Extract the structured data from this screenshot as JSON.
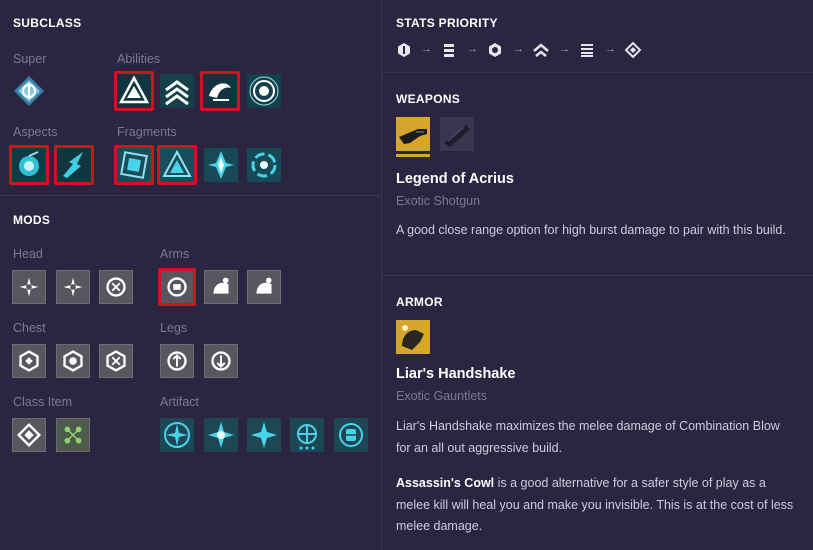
{
  "subclass": {
    "title": "SUBCLASS",
    "super_label": "Super",
    "abilities_label": "Abilities",
    "aspects_label": "Aspects",
    "fragments_label": "Fragments"
  },
  "mods": {
    "title": "MODS",
    "head_label": "Head",
    "arms_label": "Arms",
    "chest_label": "Chest",
    "legs_label": "Legs",
    "class_item_label": "Class Item",
    "artifact_label": "Artifact"
  },
  "stats": {
    "title": "STATS PRIORITY",
    "icons": [
      "mobility-icon",
      "resilience-icon",
      "recovery-icon",
      "discipline-icon",
      "intellect-icon",
      "strength-icon"
    ],
    "arrow": "→"
  },
  "weapons": {
    "title": "WEAPONS",
    "name": "Legend of Acrius",
    "type": "Exotic Shotgun",
    "description": "A good close range option for high burst damage to pair with this build."
  },
  "armor": {
    "title": "ARMOR",
    "name": "Liar's Handshake",
    "type": "Exotic Gauntlets",
    "description": "Liar's Handshake maximizes the melee damage of Combination Blow for an all out aggressive build.",
    "alt_name": "Assassin's Cowl",
    "alt_description": " is a good alternative for a safer style of play as a melee kill will heal you and make you invisible. This is at the cost of less melee damage."
  },
  "colors": {
    "background": "#2b2541",
    "selected_border": "#d0131f",
    "weapon_highlight": "#d4a72c",
    "arc_teal": "#4ad3e8"
  }
}
